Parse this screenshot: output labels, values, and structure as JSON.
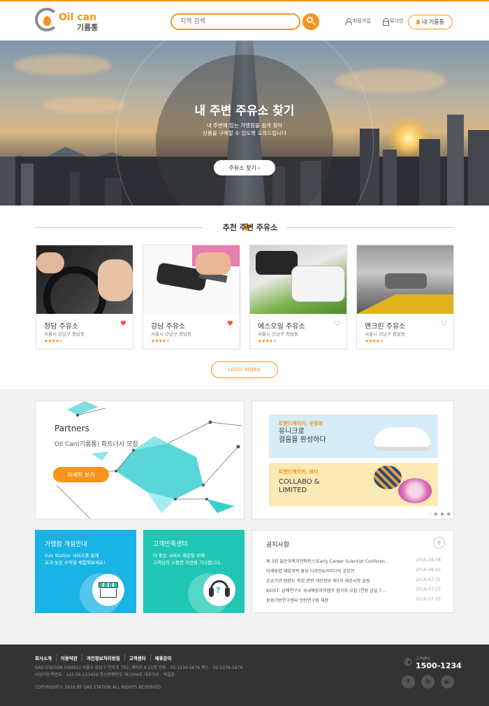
{
  "header": {
    "logo_text": "Oil can",
    "logo_sub": "기름통",
    "search_placeholder": "지역 검색",
    "signup": "회원가입",
    "login": "로그인",
    "my_button": "내 기름통"
  },
  "hero": {
    "title": "내 주변 주유소 찾기",
    "subtitle_line1": "내 주변에 있는 가맹점을 쉽게 찾아",
    "subtitle_line2": "상품을 구매할 수 있도록 도와드립니다",
    "cta": "주유소 찾기 ›"
  },
  "recommend": {
    "title": "추천 주변 주유소",
    "cards": [
      {
        "name": "청담 주유소",
        "address": "서울시 강남구 청담동",
        "rating": 4,
        "liked": true
      },
      {
        "name": "강남 주유소",
        "address": "서울시 강남구 청담동",
        "rating": 4,
        "liked": true
      },
      {
        "name": "에스오일 주유소",
        "address": "서울시 강남구 청담동",
        "rating": 4,
        "liked": false
      },
      {
        "name": "엔크린 주유소",
        "address": "서울시 강남구 청담동",
        "rating": 4,
        "liked": false
      }
    ],
    "load_more": "LOAD MORE"
  },
  "partners": {
    "title": "Partners",
    "subtitle": "Oil Can(기름통) 파트너사 모집",
    "button": "자세히 보기"
  },
  "ads": [
    {
      "tag": "트렌드메이커, 운동화",
      "line1": "유니크로",
      "line2": "걸음을 완성하다",
      "bg": "#d6ecf6"
    },
    {
      "tag": "트렌드메이커, 뷰티",
      "line1": "COLLABO &",
      "line2": "LIMITED",
      "bg": "#fbe9b6"
    }
  ],
  "ads_pager": "‹ ● ● ● ›",
  "tiles": [
    {
      "title": "가맹점 개설안내",
      "line1": "Gas Station 서비스를 통해",
      "line2": "효과 높은 수익을 체험해보세요!",
      "color": "#19b3e6",
      "icon": "shop-icon"
    },
    {
      "title": "고객만족센터",
      "line1": "더 좋은 서비스 제공을 위해",
      "line2": "고객님의 소중한 의견을 기다립니다.",
      "color": "#1fc7b4",
      "icon": "headset-icon"
    }
  ],
  "notice": {
    "title": "공지사항",
    "plus": "+",
    "items": [
      {
        "title": "제 3회 젊은과학자컨퍼런스(Early Career Scientist Conferen...",
        "date": "2016-08-08"
      },
      {
        "title": "미래융합 해양과학 홍보 디자인&아이디어 공모전",
        "date": "2016-08-02"
      },
      {
        "title": "공공기관 청렴도 측정 관련 개인정보 제3자 제공사항 알림",
        "date": "2016-07-31"
      },
      {
        "title": "KIOST- 남해연구소 국내해양과학캠프 참가자 모집 (연장 금일 7...",
        "date": "2016-07-27"
      },
      {
        "title": "환경기반연구센터 인턴연구원 채용",
        "date": "2016-07-25"
      }
    ]
  },
  "footer": {
    "nav": [
      "회사소개",
      "이용약관",
      "개인정보처리방침",
      "고객센터",
      "제휴문의"
    ],
    "info_line1": "GAS STATION (06061) 서울시 강남구 언주로 702, 레이트-Ⅱ 11층   전화 : 02-1234-5678   팩스 : 02-1234-5678",
    "info_line2": "사업자등록번호 : 123-56-123456   통신판매번호 제1004호   대표이사 : 박철훈",
    "copyright": "COPYRIGHT© 2016 BY GAS STATION ALL RIGHTS RESERVED.",
    "call_label": "고객센터",
    "call_number": "1500-1234",
    "sns": [
      "f",
      "b",
      "▶"
    ]
  },
  "colors": {
    "accent": "#f7941d",
    "footer": "#333333"
  }
}
